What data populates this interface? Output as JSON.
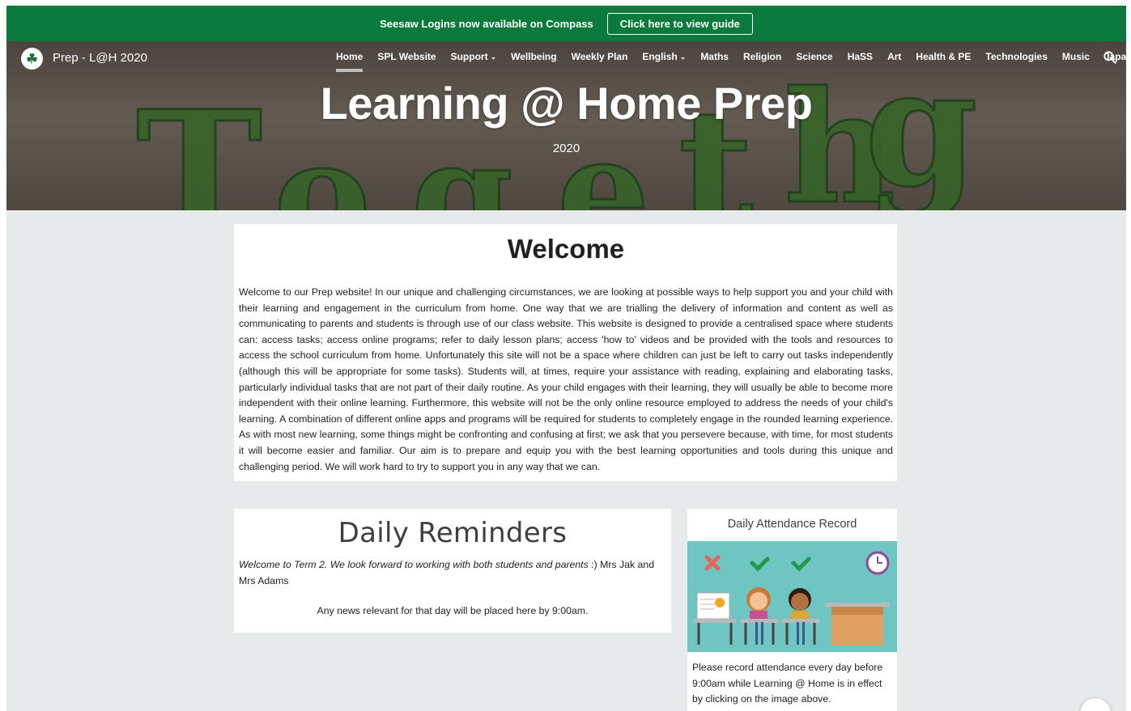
{
  "banner": {
    "text": "Seesaw Logins now available on Compass",
    "button_label": "Click here to view guide",
    "color": "#0a7a3c"
  },
  "site": {
    "name": "Prep - L@H 2020",
    "logo_icon": "shamrock-icon"
  },
  "nav": {
    "items": [
      {
        "label": "Home",
        "active": true
      },
      {
        "label": "SPL Website"
      },
      {
        "label": "Support",
        "dropdown": true
      },
      {
        "label": "Wellbeing"
      },
      {
        "label": "Weekly Plan"
      },
      {
        "label": "English",
        "dropdown": true
      },
      {
        "label": "Maths"
      },
      {
        "label": "Religion"
      },
      {
        "label": "Science"
      },
      {
        "label": "HaSS"
      },
      {
        "label": "Art"
      },
      {
        "label": "Health & PE"
      },
      {
        "label": "Technologies"
      },
      {
        "label": "Music"
      },
      {
        "label": "Japanese"
      }
    ],
    "search_icon": "search-icon"
  },
  "hero": {
    "title": "Learning @ Home Prep",
    "subtitle": "2020"
  },
  "welcome": {
    "heading": "Welcome",
    "body": "Welcome to our Prep website! In our unique and challenging circumstances, we are looking at possible ways to help support you and your child with their learning and engagement in the curriculum from home. One way that we are trialling the delivery of information and content as well as communicating to parents and students is through use of our class website. This website is designed to provide a centralised space where students can: access tasks; access online programs; refer to daily lesson plans; access 'how to' videos and be provided with the tools and resources to access the school curriculum from home. Unfortunately this site will not be a space where children can just be left to carry out tasks independently (although this will be appropriate for some tasks). Students will, at times, require your assistance with reading, explaining and elaborating tasks, particularly individual tasks that are not part of their daily routine. As your child engages with their learning, they will usually be able to become more independent with their online learning. Furthermore, this website will not be the only online resource employed to address the needs of your child's learning. A combination of different online apps and programs will be required for students to completely engage in the rounded learning experience. As with most new learning, some things might be confronting and confusing at first; we ask that you persevere because, with time, for most students it will become easier and familiar. Our aim is to prepare and equip you with the best learning opportunities and tools during this unique and challenging period. We will work hard to try to support you in any way that we can."
  },
  "reminders": {
    "heading": "Daily Reminders",
    "italic_text": "Welcome to Term 2.  We look forward to working with both students and parents",
    "sign_off": " :) Mrs Jak and Mrs Adams",
    "news": "Any news relevant for that day will be placed here by 9:00am."
  },
  "attendance": {
    "heading": "Daily Attendance Record",
    "image_icon": "attendance-illustration",
    "note": "Please record attendance every day before 9:00am while Learning @ Home is in effect by clicking on the image above."
  }
}
